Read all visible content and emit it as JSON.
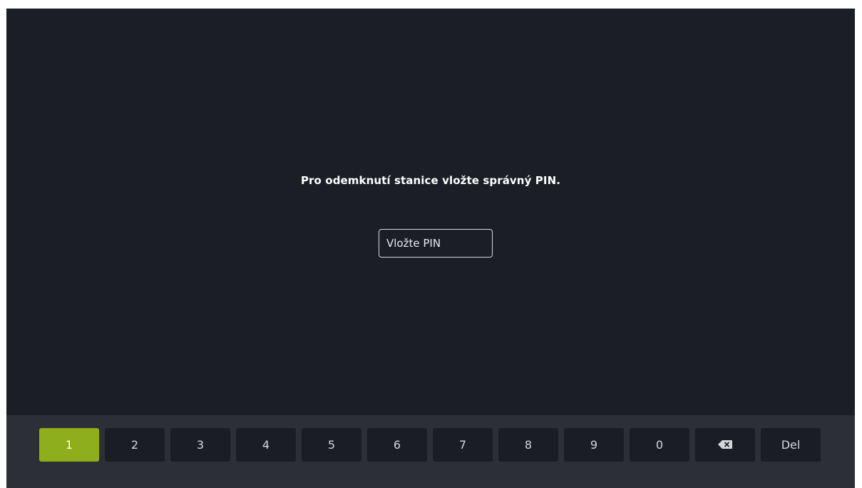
{
  "prompt": {
    "text": "Pro odemknutí stanice vložte správný PIN."
  },
  "pin_input": {
    "placeholder": "Vložte PIN",
    "value": ""
  },
  "keyboard": {
    "active_key": "1",
    "keys": [
      {
        "label": "1"
      },
      {
        "label": "2"
      },
      {
        "label": "3"
      },
      {
        "label": "4"
      },
      {
        "label": "5"
      },
      {
        "label": "6"
      },
      {
        "label": "7"
      },
      {
        "label": "8"
      },
      {
        "label": "9"
      },
      {
        "label": "0"
      },
      {
        "icon": "backspace-icon"
      },
      {
        "label": "Del"
      }
    ]
  },
  "colors": {
    "background": "#1b1e25",
    "keyboard_background": "#2c2f36",
    "key_background": "#1a1d23",
    "active_key": "#8fae1b",
    "text": "#ffffff"
  }
}
